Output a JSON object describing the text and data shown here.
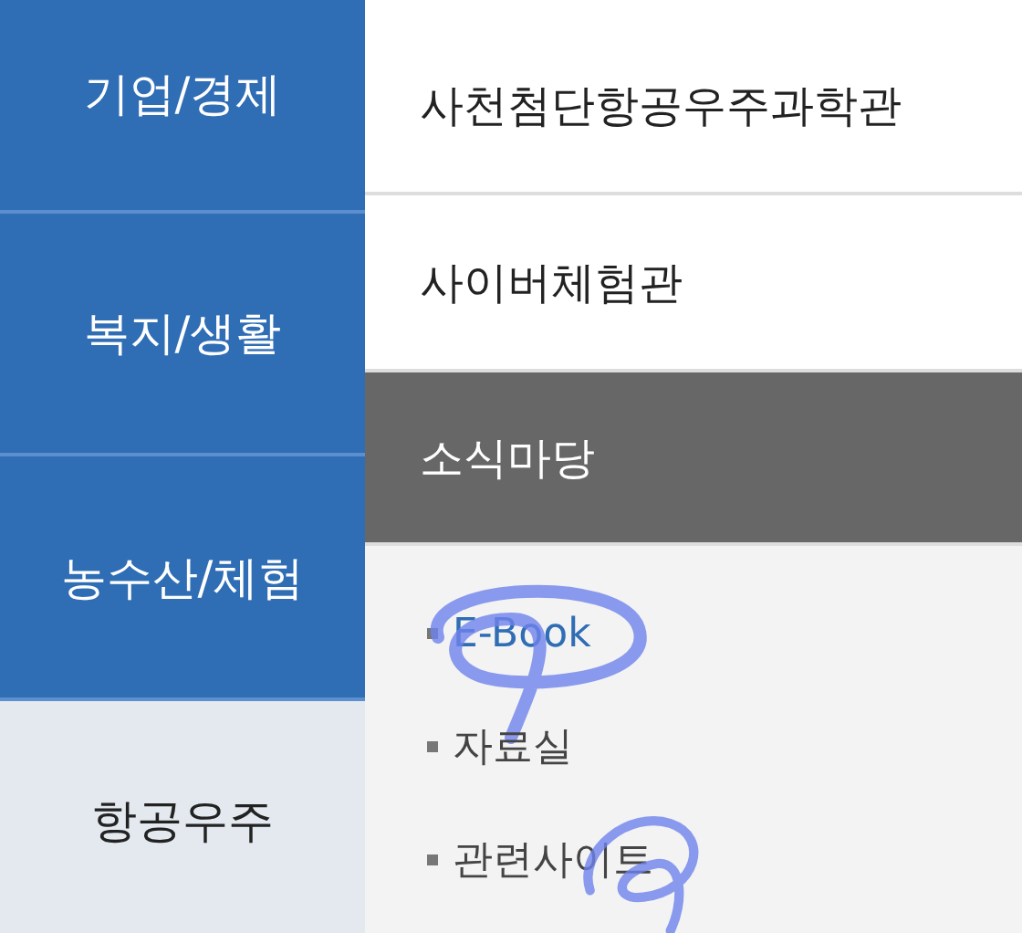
{
  "left_menu": [
    {
      "label": "기업/경제",
      "selected": false
    },
    {
      "label": "복지/생활",
      "selected": false
    },
    {
      "label": "농수산/체험",
      "selected": false
    },
    {
      "label": "항공우주",
      "selected": true
    }
  ],
  "right_menu": [
    {
      "label": "사천첨단항공우주과학관",
      "expanded": false
    },
    {
      "label": "사이버체험관",
      "expanded": false
    },
    {
      "label": "소식마당",
      "expanded": true,
      "children": [
        {
          "label": "E-Book",
          "selected": true,
          "circled": true
        },
        {
          "label": "자료실",
          "selected": false,
          "circled": false
        },
        {
          "label": "관련사이트",
          "selected": false,
          "circled": true
        }
      ]
    }
  ]
}
